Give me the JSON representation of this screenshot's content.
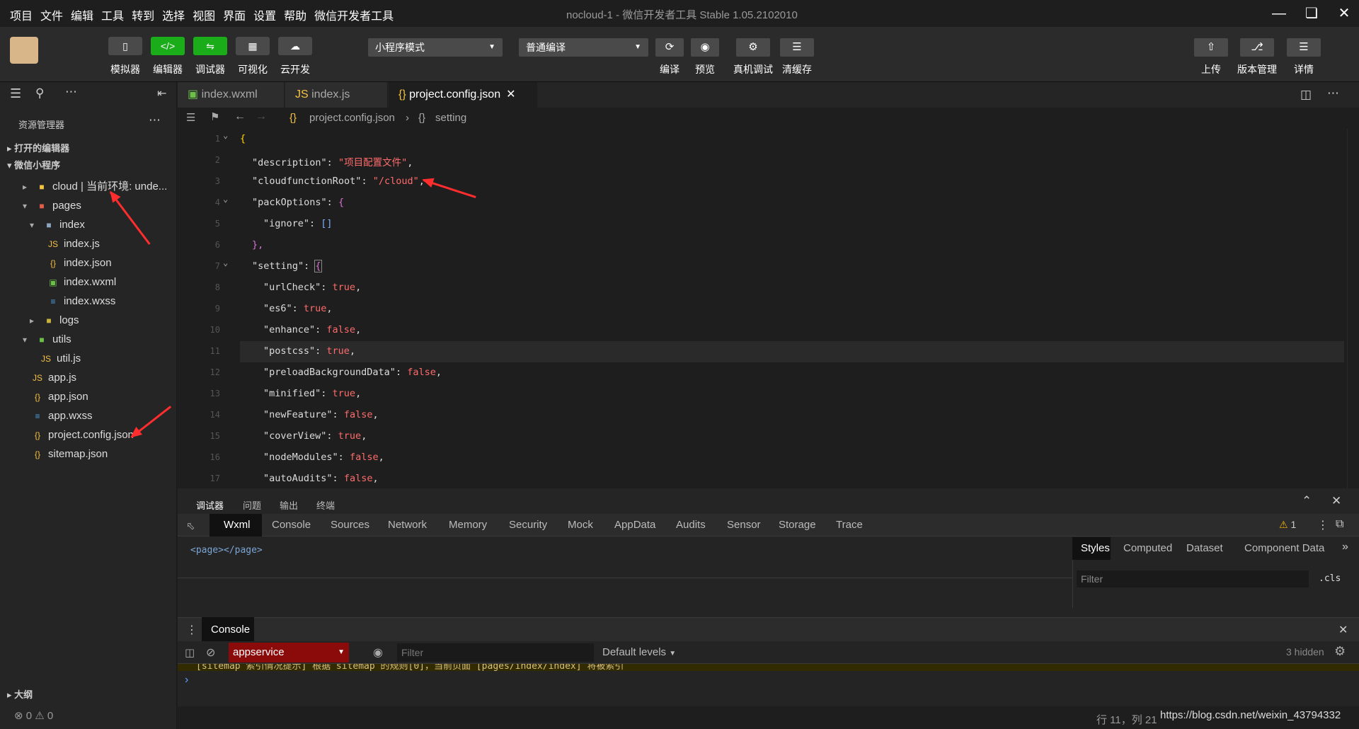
{
  "menubar": {
    "items": [
      "项目",
      "文件",
      "编辑",
      "工具",
      "转到",
      "选择",
      "视图",
      "界面",
      "设置",
      "帮助",
      "微信开发者工具"
    ],
    "title": "nocloud-1 - 微信开发者工具 Stable 1.05.2102010"
  },
  "toolbar": {
    "left_labels": [
      "模拟器",
      "编辑器",
      "调试器",
      "可视化",
      "云开发"
    ],
    "mode_select": "小程序模式",
    "compile_select": "普通编译",
    "mid_labels": [
      "编译",
      "预览",
      "真机调试",
      "清缓存"
    ],
    "right_labels": [
      "上传",
      "版本管理",
      "详情"
    ]
  },
  "sidebar": {
    "title": "资源管理器",
    "section_open": "打开的编辑器",
    "section_project": "微信小程序",
    "outline": "大纲",
    "tree": [
      {
        "label": "cloud | 当前环境: unde...",
        "icon": "folder-cloud-icon"
      },
      {
        "label": "pages",
        "icon": "folder-icon"
      },
      {
        "label": "index",
        "icon": "folder-icon"
      },
      {
        "label": "index.js",
        "icon": "js-file-icon"
      },
      {
        "label": "index.json",
        "icon": "json-file-icon"
      },
      {
        "label": "index.wxml",
        "icon": "wxml-file-icon"
      },
      {
        "label": "index.wxss",
        "icon": "wxss-file-icon"
      },
      {
        "label": "logs",
        "icon": "folder-icon"
      },
      {
        "label": "utils",
        "icon": "folder-icon"
      },
      {
        "label": "util.js",
        "icon": "js-file-icon"
      },
      {
        "label": "app.js",
        "icon": "js-file-icon"
      },
      {
        "label": "app.json",
        "icon": "json-file-icon"
      },
      {
        "label": "app.wxss",
        "icon": "wxss-file-icon"
      },
      {
        "label": "project.config.json",
        "icon": "json-file-icon"
      },
      {
        "label": "sitemap.json",
        "icon": "json-file-icon"
      }
    ],
    "errors": "0",
    "warnings": "0"
  },
  "tabs": [
    {
      "label": "index.wxml"
    },
    {
      "label": "index.js"
    },
    {
      "label": "project.config.json"
    }
  ],
  "breadcrumb": {
    "file": "project.config.json",
    "sep": "›",
    "node": "setting"
  },
  "code": {
    "line_numbers": [
      "1",
      "2",
      "3",
      "4",
      "5",
      "6",
      "7",
      "8",
      "9",
      "10",
      "11",
      "12",
      "13",
      "14",
      "15",
      "16",
      "17"
    ],
    "l1": "{",
    "l2_key": "\"description\"",
    "l2_val": "\"项目配置文件\"",
    "l3_key": "\"cloudfunctionRoot\"",
    "l3_val": "\"/cloud\"",
    "l4_key": "\"packOptions\"",
    "l5_key": "\"ignore\"",
    "l5_val": "[]",
    "l6": "},",
    "l7_key": "\"setting\"",
    "l8_key": "\"urlCheck\"",
    "l8_val": "true",
    "l9_key": "\"es6\"",
    "l9_val": "true",
    "l10_key": "\"enhance\"",
    "l10_val": "false",
    "l11_key": "\"postcss\"",
    "l11_val": "true",
    "l12_key": "\"preloadBackgroundData\"",
    "l12_val": "false",
    "l13_key": "\"minified\"",
    "l13_val": "true",
    "l14_key": "\"newFeature\"",
    "l14_val": "false",
    "l15_key": "\"coverView\"",
    "l15_val": "true",
    "l16_key": "\"nodeModules\"",
    "l16_val": "false",
    "l17_key": "\"autoAudits\"",
    "l17_val": "false"
  },
  "debug": {
    "top_tabs": [
      "调试器",
      "问题",
      "输出",
      "终端"
    ],
    "devtabs": [
      "Wxml",
      "Console",
      "Sources",
      "Network",
      "Memory",
      "Security",
      "Mock",
      "AppData",
      "Audits",
      "Sensor",
      "Storage",
      "Trace"
    ],
    "warn_count": "1",
    "wxml_content": "<page></page>",
    "style_tabs": [
      "Styles",
      "Computed",
      "Dataset",
      "Component Data"
    ],
    "filter_placeholder": "Filter",
    "cls": ".cls",
    "console_tab": "Console",
    "context": "appservice",
    "console_filter": "Filter",
    "levels": "Default levels",
    "hidden": "3 hidden",
    "prompt": "›",
    "warning_line": "[sitemap 索引情况提示] 根据 sitemap 的规则[0]，当前页面 [pages/index/index] 将被索引"
  },
  "status": {
    "position": "行 11，列 21",
    "watermark": "https://blog.csdn.net/weixin_43794332"
  },
  "colors": {
    "accent_green": "#1aad19",
    "annotation_red": "#ff2d2d"
  }
}
